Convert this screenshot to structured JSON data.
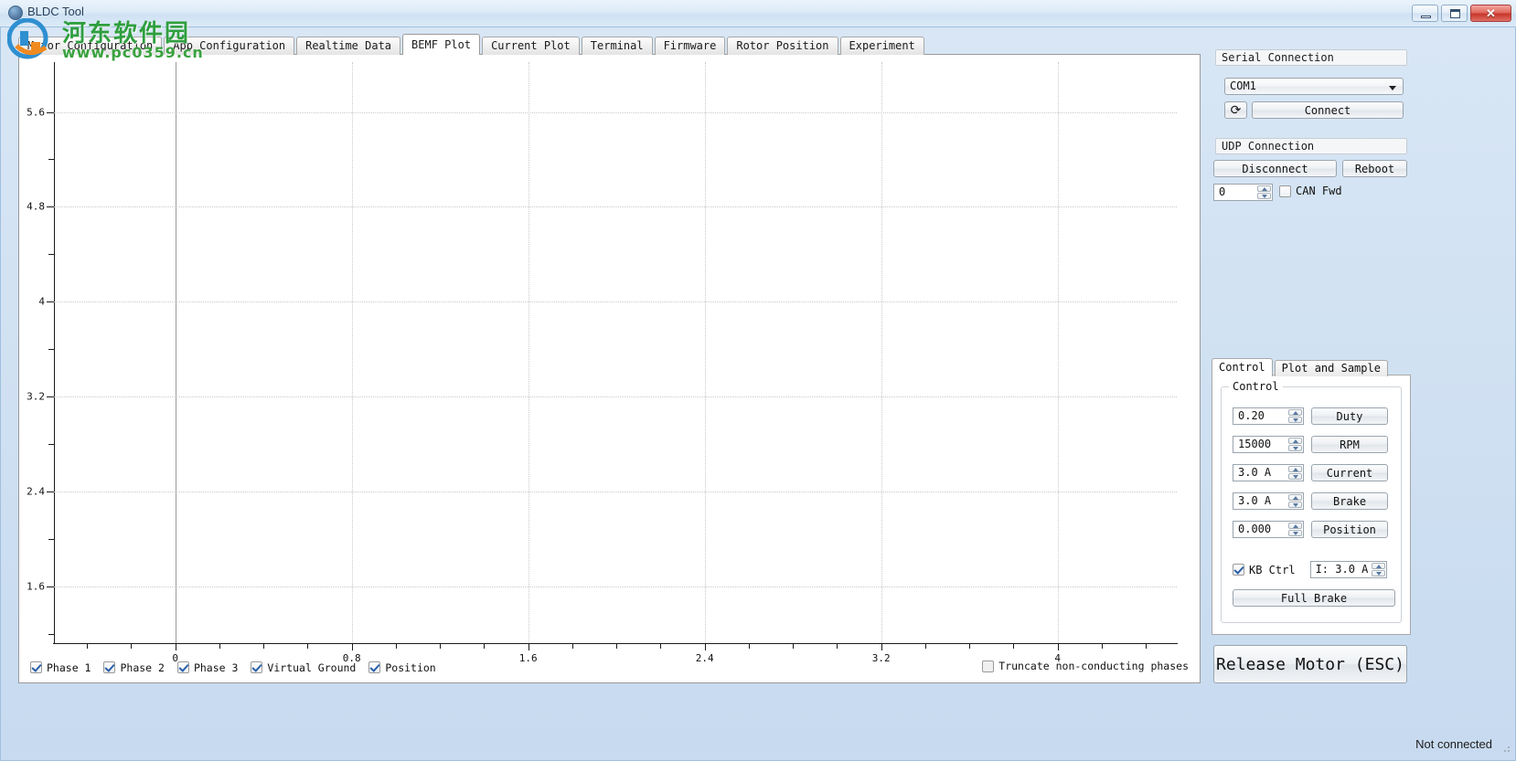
{
  "window": {
    "title": "BLDC Tool",
    "minimize_label": "",
    "maximize_label": "",
    "close_label": "✕"
  },
  "watermark": {
    "cn_text": "河东软件园",
    "url_text": "www.pc0359.cn"
  },
  "tabs": [
    {
      "label": "Motor Configuration",
      "active": false
    },
    {
      "label": "App Configuration",
      "active": false
    },
    {
      "label": "Realtime Data",
      "active": false
    },
    {
      "label": "BEMF Plot",
      "active": true
    },
    {
      "label": "Current Plot",
      "active": false
    },
    {
      "label": "Terminal",
      "active": false
    },
    {
      "label": "Firmware",
      "active": false
    },
    {
      "label": "Rotor Position",
      "active": false
    },
    {
      "label": "Experiment",
      "active": false
    }
  ],
  "chart_data": {
    "type": "line",
    "title": "",
    "xlabel": "",
    "ylabel": "",
    "series": [],
    "x_ticks": [
      "0",
      "0.8",
      "1.6",
      "2.4",
      "3.2",
      "4"
    ],
    "x_tick_values": [
      0,
      0.8,
      1.6,
      2.4,
      3.2,
      4
    ],
    "xlim": [
      -0.55,
      4.54
    ],
    "y_ticks": [
      "1.6",
      "2.4",
      "3.2",
      "4",
      "4.8",
      "5.6"
    ],
    "y_tick_values": [
      1.6,
      2.4,
      3.2,
      4,
      4.8,
      5.6
    ],
    "ylim": [
      1.12,
      6.02
    ],
    "grid": true,
    "legend_position": "bottom"
  },
  "plot_legend": {
    "items": [
      {
        "label": "Phase 1",
        "checked": true
      },
      {
        "label": "Phase 2",
        "checked": true
      },
      {
        "label": "Phase 3",
        "checked": true
      },
      {
        "label": "Virtual Ground",
        "checked": true
      },
      {
        "label": "Position",
        "checked": true
      }
    ],
    "truncate": {
      "label": "Truncate non-conducting phases",
      "checked": false
    }
  },
  "serial": {
    "group_title": "Serial Connection",
    "port_value": "COM1",
    "refresh_icon": "⟳",
    "connect_label": "Connect"
  },
  "udp": {
    "group_title": "UDP Connection",
    "disconnect_label": "Disconnect",
    "reboot_label": "Reboot",
    "id_value": "0",
    "can_fwd_label": "CAN Fwd",
    "can_fwd_checked": false
  },
  "lower_tabs": [
    {
      "label": "Control",
      "active": true
    },
    {
      "label": "Plot and Sample",
      "active": false
    }
  ],
  "control": {
    "fieldset_title": "Control",
    "rows": [
      {
        "value": "0.20",
        "button": "Duty"
      },
      {
        "value": "15000",
        "button": "RPM"
      },
      {
        "value": "3.0 A",
        "button": "Current"
      },
      {
        "value": "3.0 A",
        "button": "Brake"
      },
      {
        "value": "0.000",
        "button": "Position"
      }
    ],
    "kb_ctrl_label": "KB Ctrl",
    "kb_ctrl_checked": true,
    "current_value": "I: 3.0 A",
    "full_brake_label": "Full Brake"
  },
  "release_motor_label": "Release Motor (ESC)",
  "statusbar": {
    "text": "Not connected"
  }
}
